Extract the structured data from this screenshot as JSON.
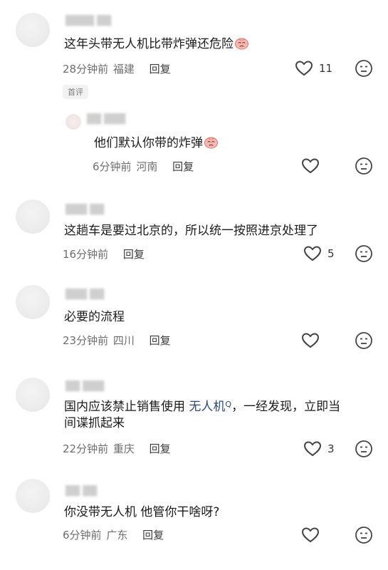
{
  "comments": [
    {
      "text": "这年头带无人机比带炸弹还危险",
      "time": "28分钟前",
      "location": "福建",
      "reply_label": "回复",
      "likes": "11",
      "badge": "首评",
      "emoji": "crying-face"
    },
    {
      "text": "他们默认你带的炸弹",
      "time": "6分钟前",
      "location": "河南",
      "reply_label": "回复",
      "likes": "",
      "emoji": "crying-face"
    },
    {
      "text": "这趟车是要过北京的，所以统一按照进京处理了",
      "time": "16分钟前",
      "location": "",
      "reply_label": "回复",
      "likes": "5"
    },
    {
      "text": "必要的流程",
      "time": "23分钟前",
      "location": "四川",
      "reply_label": "回复",
      "likes": ""
    },
    {
      "text_before": "国内应该禁止销售使用 ",
      "link": "无人机",
      "link_marker": "Q",
      "text_after": "，一经发现，立即当",
      "text_line2": "间谍抓起来",
      "time": "22分钟前",
      "location": "重庆",
      "reply_label": "回复",
      "likes": "3"
    },
    {
      "text": "你没带无人机 他管你干啥呀?",
      "time": "6分钟前",
      "location": "广东",
      "reply_label": "回复",
      "likes": ""
    }
  ],
  "colors": {
    "text": "#1b1b1b",
    "meta": "#6e6e6e",
    "link": "#2f4a7a",
    "icon": "#444444"
  }
}
